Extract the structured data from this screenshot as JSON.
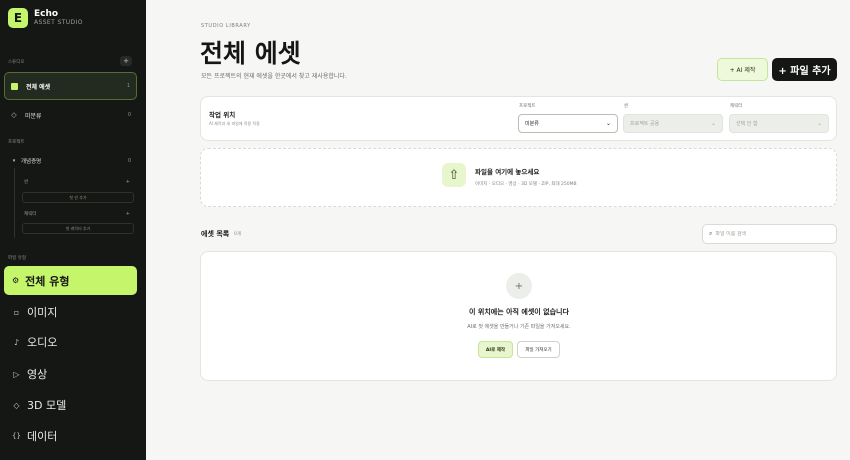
{
  "brand": {
    "logo_letter": "E",
    "name": "Echo",
    "subtitle": "ASSET STUDIO"
  },
  "sidebar": {
    "studio_label": "스튜디오",
    "add_label": "+",
    "all_assets": {
      "label": "전체 에셋",
      "count": "1"
    },
    "unclassified": {
      "label": "미분류",
      "count": "0"
    },
    "project_label": "프로젝트",
    "project": {
      "label": "개념증명",
      "count": "0"
    },
    "sub_items": [
      {
        "label": "씬",
        "action": "+",
        "add_label": "첫 씬 추가"
      },
      {
        "label": "캐릭터",
        "action": "+",
        "add_label": "첫 캐릭터 추가"
      }
    ],
    "type_label": "파일 유형",
    "types": [
      {
        "label": "전체 유형",
        "icon": "settings-icon"
      },
      {
        "label": "이미지",
        "icon": "image-icon"
      },
      {
        "label": "오디오",
        "icon": "music-icon"
      },
      {
        "label": "영상",
        "icon": "play-icon"
      },
      {
        "label": "3D 모델",
        "icon": "cube-icon"
      },
      {
        "label": "데이터",
        "icon": "braces-icon"
      }
    ]
  },
  "header": {
    "eyebrow": "STUDIO LIBRARY",
    "title": "전체 에셋",
    "subtitle": "모든 프로젝트의 현재 에셋을 한곳에서 찾고 재사용합니다.",
    "ai_button": "+ AI 제작",
    "add_button": "+ 파일 추가"
  },
  "location": {
    "title": "작업 위치",
    "hint": "AI 제작과 새 파일에 적용 적용",
    "fields": [
      {
        "label": "프로젝트",
        "value": "미분류",
        "enabled": true
      },
      {
        "label": "씬",
        "value": "프로젝트 공용",
        "enabled": false
      },
      {
        "label": "캐릭터",
        "value": "선택 안 함",
        "enabled": false
      }
    ]
  },
  "dropzone": {
    "title": "파일을 여기에 놓으세요",
    "subtitle": "이미지 · 오디오 · 영상 · 3D 모델 · ZIP, 최대 250MB"
  },
  "asset_list": {
    "title": "에셋 목록",
    "count": "0개",
    "search_placeholder": "파일 이름 검색"
  },
  "empty_state": {
    "icon": "+",
    "title": "이 위치에는 아직 에셋이 없습니다",
    "subtitle": "AI로 첫 에셋을 만들거나 기존 파일을 가져오세요.",
    "ai_button": "AI로 제작",
    "import_button": "파일 가져오기"
  },
  "colors": {
    "accent": "#c4f56b",
    "sidebar_bg": "#141714",
    "page_bg": "#f6f6f4"
  }
}
